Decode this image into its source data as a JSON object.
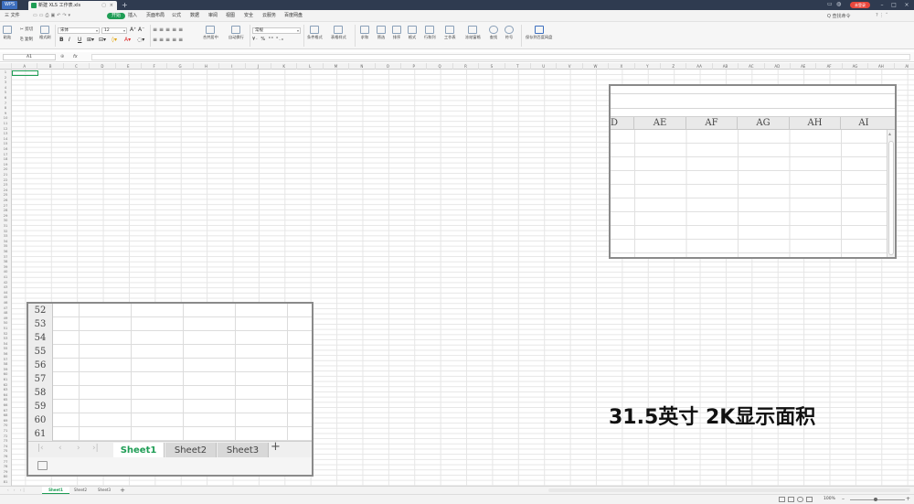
{
  "titlebar": {
    "app_name": "WPS",
    "doc_tab": "新建 XLS 工作表.xls",
    "user_btn": "未登录",
    "new_tab": "+"
  },
  "menubar": {
    "file": "三 文件",
    "items": [
      "开始",
      "插入",
      "页面布局",
      "公式",
      "数据",
      "审阅",
      "视图",
      "安全",
      "云服务",
      "百度网盘"
    ],
    "active_index": 0,
    "search": "Q 查找命令"
  },
  "ribbon": {
    "paste": "粘贴",
    "cut": "剪切",
    "copy": "复制",
    "format_painter": "格式刷",
    "font_name": "宋体",
    "font_size": "12",
    "bold": "B",
    "italic": "I",
    "underline": "U",
    "merge_center": "合并居中",
    "auto_wrap": "自动换行",
    "number_format": "常规",
    "cond_format": "条件格式",
    "table_style": "表格样式",
    "sum": "求和",
    "filter": "筛选",
    "sort": "排序",
    "format": "格式",
    "rowcol": "行和列",
    "worksheet": "工作表",
    "freeze": "冻结窗格",
    "find": "查找",
    "symbol": "符号",
    "save_baidu": "保存到百度网盘"
  },
  "formulabar": {
    "name_box": "A1",
    "fx": "fx"
  },
  "columns": [
    "A",
    "B",
    "C",
    "D",
    "E",
    "F",
    "G",
    "H",
    "I",
    "J",
    "K",
    "L",
    "M",
    "N",
    "O",
    "P",
    "Q",
    "R",
    "S",
    "T",
    "U",
    "V",
    "W",
    "X",
    "Y",
    "Z",
    "AA",
    "AB",
    "AC",
    "AD",
    "AE",
    "AF",
    "AG",
    "AH",
    "AI"
  ],
  "row_count": 81,
  "sheet_tabs": [
    "Sheet1",
    "Sheet2",
    "Sheet3"
  ],
  "status": {
    "zoom": "100%"
  },
  "zoom_right": {
    "columns": [
      "AE",
      "AF",
      "AG",
      "AH",
      "AI"
    ],
    "partial_left": "D"
  },
  "zoom_left": {
    "rows": [
      "52",
      "53",
      "54",
      "55",
      "56",
      "57",
      "58",
      "59",
      "60",
      "61"
    ],
    "tabs": [
      "Sheet1",
      "Sheet2",
      "Sheet3"
    ],
    "plus": "+"
  },
  "caption": "31.5英寸 2K显示面积",
  "colors": {
    "accent": "#1f9d55",
    "titlebar": "#2f3b50",
    "user_btn": "#e8473d"
  }
}
